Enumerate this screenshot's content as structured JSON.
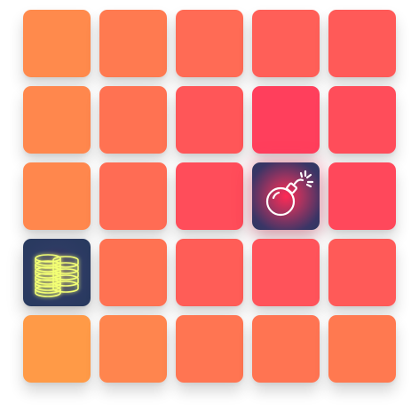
{
  "grid": {
    "rows": 5,
    "cols": 5,
    "tiles": [
      {
        "row": 0,
        "col": 0,
        "state": "hidden",
        "color": "#ff8a4c"
      },
      {
        "row": 0,
        "col": 1,
        "state": "hidden",
        "color": "#ff7a50"
      },
      {
        "row": 0,
        "col": 2,
        "state": "hidden",
        "color": "#ff6b55"
      },
      {
        "row": 0,
        "col": 3,
        "state": "hidden",
        "color": "#ff5f58"
      },
      {
        "row": 0,
        "col": 4,
        "state": "hidden",
        "color": "#ff5a58"
      },
      {
        "row": 1,
        "col": 0,
        "state": "hidden",
        "color": "#ff874d"
      },
      {
        "row": 1,
        "col": 1,
        "state": "hidden",
        "color": "#ff7252"
      },
      {
        "row": 1,
        "col": 2,
        "state": "hidden",
        "color": "#ff5658"
      },
      {
        "row": 1,
        "col": 3,
        "state": "hidden",
        "color": "#ff3f5c"
      },
      {
        "row": 1,
        "col": 4,
        "state": "hidden",
        "color": "#ff4d5a"
      },
      {
        "row": 2,
        "col": 0,
        "state": "hidden",
        "color": "#ff874d"
      },
      {
        "row": 2,
        "col": 1,
        "state": "hidden",
        "color": "#ff6c54"
      },
      {
        "row": 2,
        "col": 2,
        "state": "hidden",
        "color": "#ff4d5a"
      },
      {
        "row": 2,
        "col": 3,
        "state": "bomb",
        "icon": "bomb-icon"
      },
      {
        "row": 2,
        "col": 4,
        "state": "hidden",
        "color": "#ff485b"
      },
      {
        "row": 3,
        "col": 0,
        "state": "coins",
        "icon": "coin-stack-icon"
      },
      {
        "row": 3,
        "col": 1,
        "state": "hidden",
        "color": "#ff7252"
      },
      {
        "row": 3,
        "col": 2,
        "state": "hidden",
        "color": "#ff5d57"
      },
      {
        "row": 3,
        "col": 3,
        "state": "hidden",
        "color": "#ff535a"
      },
      {
        "row": 3,
        "col": 4,
        "state": "hidden",
        "color": "#ff5a58"
      },
      {
        "row": 4,
        "col": 0,
        "state": "hidden",
        "color": "#ff9a47"
      },
      {
        "row": 4,
        "col": 1,
        "state": "hidden",
        "color": "#ff854e"
      },
      {
        "row": 4,
        "col": 2,
        "state": "hidden",
        "color": "#ff7552"
      },
      {
        "row": 4,
        "col": 3,
        "state": "hidden",
        "color": "#ff7452"
      },
      {
        "row": 4,
        "col": 4,
        "state": "hidden",
        "color": "#ff7950"
      }
    ]
  },
  "colors": {
    "icon_glow_coin": "#f3ff74",
    "icon_stroke": "#ffffff"
  }
}
